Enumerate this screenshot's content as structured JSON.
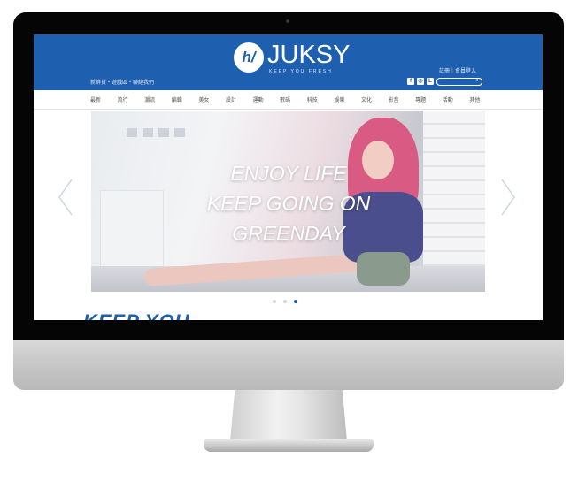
{
  "site": {
    "logo_mark": "h/",
    "logo_text": "JUKSY",
    "tagline": "KEEP YOU FRESH",
    "breadcrumb": "新鮮貨・遊戲區・聯絡我們",
    "account_links": "註冊｜會員登入",
    "social_icons": [
      "facebook-icon",
      "instagram-icon",
      "line-icon"
    ]
  },
  "nav": {
    "items": [
      "最新",
      "流行",
      "潮流",
      "編輯",
      "美女",
      "設計",
      "運動",
      "數碼",
      "科技",
      "娛樂",
      "文化",
      "影音",
      "專題",
      "活動",
      "其他"
    ]
  },
  "hero": {
    "lines": [
      "ENJOY LIFE",
      "KEEP GOING ON",
      "GREENDAY"
    ],
    "slide_count": 3,
    "active_slide": 3
  },
  "section": {
    "title": "KEEP YOU"
  },
  "colors": {
    "brand_blue": "#1f5fb0",
    "hero_text": "#ffffff"
  }
}
